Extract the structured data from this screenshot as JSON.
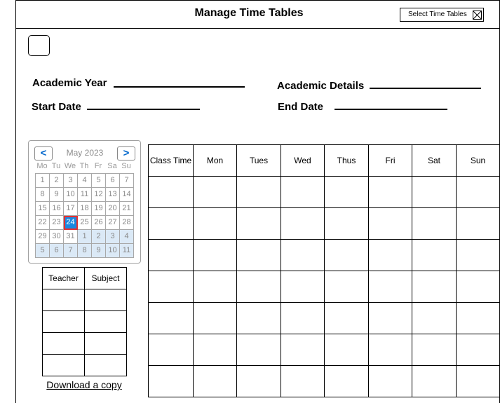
{
  "header": {
    "title": "Manage Time Tables",
    "select_button_label": "Select Time Tables"
  },
  "form": {
    "academic_year_label": "Academic Year",
    "academic_details_label": "Academic Details",
    "start_date_label": "Start Date",
    "end_date_label": "End Date"
  },
  "calendar": {
    "month_label": "May 2023",
    "prev_label": "<",
    "next_label": ">",
    "weekdays": [
      "Mo",
      "Tu",
      "We",
      "Th",
      "Fr",
      "Sa",
      "Su"
    ],
    "selected_day": "24",
    "weeks": [
      [
        "1",
        "2",
        "3",
        "4",
        "5",
        "6",
        "7"
      ],
      [
        "8",
        "9",
        "10",
        "11",
        "12",
        "13",
        "14"
      ],
      [
        "15",
        "16",
        "17",
        "18",
        "19",
        "20",
        "21"
      ],
      [
        "22",
        "23",
        "24",
        "25",
        "26",
        "27",
        "28"
      ],
      [
        "29",
        "30",
        "31",
        "1",
        "2",
        "3",
        "4"
      ],
      [
        "5",
        "6",
        "7",
        "8",
        "9",
        "10",
        "11"
      ]
    ],
    "colors": {
      "selected_bg": "#1a88e0",
      "selected_border": "#e53030",
      "next_month_bg": "#dbe9f6",
      "nav_arrow": "#0066cc"
    }
  },
  "teacher_table": {
    "headers": [
      "Teacher",
      "Subject"
    ],
    "rows": 4
  },
  "download_label": "Download a copy",
  "timetable": {
    "headers": [
      "Class Time",
      "Mon",
      "Tues",
      "Wed",
      "Thus",
      "Fri",
      "Sat",
      "Sun"
    ],
    "rows": 7
  }
}
